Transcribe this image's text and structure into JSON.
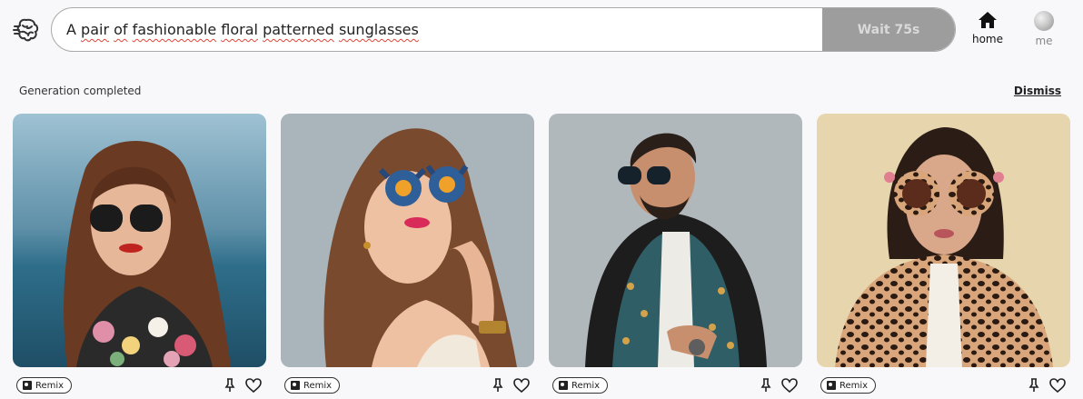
{
  "search": {
    "value_plain_start": "A ",
    "value_words": [
      "pair",
      "of",
      "fashionable",
      "floral",
      "patterned",
      "sunglasses"
    ],
    "value": "A pair of fashionable floral patterned sunglasses"
  },
  "wait_button": "Wait 75s",
  "nav": {
    "home": "home",
    "me": "me"
  },
  "status": {
    "message": "Generation completed",
    "dismiss": "Dismiss"
  },
  "cards": [
    {
      "remix": "Remix",
      "description": "woman with dark sunglasses and floral jacket by the sea"
    },
    {
      "remix": "Remix",
      "description": "woman with blue floral flower sunglasses"
    },
    {
      "remix": "Remix",
      "description": "bearded man with sunglasses and patterned jacket"
    },
    {
      "remix": "Remix",
      "description": "woman with leopard print glasses and jacket"
    }
  ],
  "icons": [
    "brain-logo-icon",
    "home-icon",
    "avatar-icon",
    "remix-icon",
    "pin-icon",
    "heart-icon"
  ],
  "colors": {
    "wait_bg": "#9d9d9d",
    "page_bg": "#f8f7fa"
  }
}
